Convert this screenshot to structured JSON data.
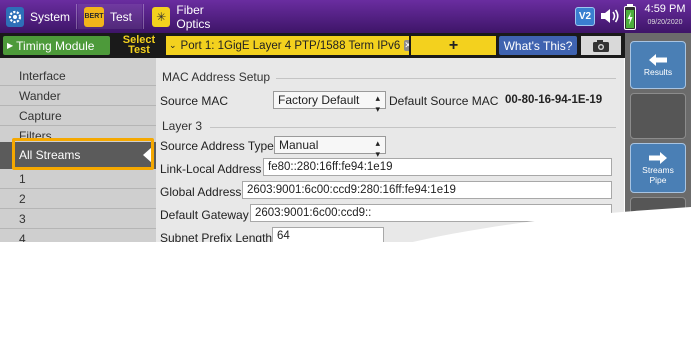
{
  "topbar": {
    "system_label": "System",
    "test_label": "Test",
    "test_icon_text": "BERT",
    "fiber_label": "Fiber Optics",
    "version_badge": "V2",
    "time": "4:59 PM",
    "date": "09/20/2020"
  },
  "toolbar": {
    "timing_module_label": "Timing Module",
    "select_test_line1": "Select",
    "select_test_line2": "Test",
    "port_dropdown": "Port 1: 1GigE Layer 4 PTP/1588 Term IPv6",
    "add_label": "+",
    "whats_this_label": "What's This?"
  },
  "sidebar": {
    "items": [
      {
        "label": "Interface"
      },
      {
        "label": "Wander"
      },
      {
        "label": "Capture"
      },
      {
        "label": "Filters"
      },
      {
        "label": "All Streams"
      },
      {
        "label": "1"
      },
      {
        "label": "2"
      },
      {
        "label": "3"
      },
      {
        "label": "4"
      }
    ]
  },
  "main": {
    "mac_section_title": "MAC Address Setup",
    "source_mac_label": "Source MAC",
    "source_mac_select": "Factory Default",
    "default_source_mac_label": "Default Source MAC",
    "default_source_mac_value": "00-80-16-94-1E-19",
    "layer3_title": "Layer 3",
    "source_address_type_label": "Source Address Type",
    "source_address_type_value": "Manual",
    "link_local_label": "Link-Local Address",
    "link_local_value": "fe80::280:16ff:fe94:1e19",
    "global_address_label": "Global Address",
    "global_address_value": "2603:9001:6c00:ccd9:280:16ff:fe94:1e19",
    "default_gateway_label": "Default Gateway",
    "default_gateway_value": "2603:9001:6c00:ccd9::",
    "subnet_prefix_label": "Subnet Prefix Length",
    "subnet_prefix_value": "64"
  },
  "rightbar": {
    "results_label": "Results",
    "streams_pipe_line1": "Streams",
    "streams_pipe_line2": "Pipe"
  },
  "colors": {
    "topbar": "#4f1f82",
    "highlight": "#f5a800",
    "yellow": "#f3d11e",
    "timing_green": "#4d9a3a",
    "whats_blue": "#3f63b0"
  }
}
